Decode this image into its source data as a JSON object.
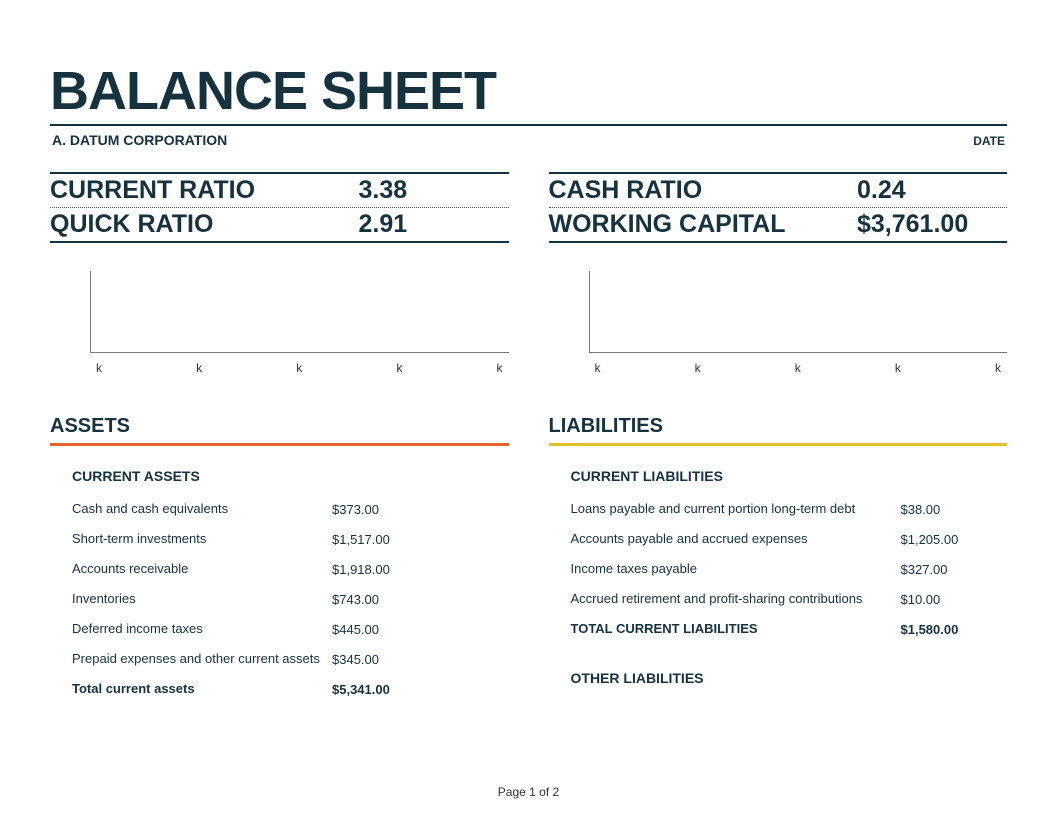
{
  "title": "BALANCE SHEET",
  "company": "A. DATUM CORPORATION",
  "date_label": "DATE",
  "ratios": {
    "left": [
      {
        "label": "CURRENT RATIO",
        "value": "3.38"
      },
      {
        "label": "QUICK RATIO",
        "value": "2.91"
      }
    ],
    "right": [
      {
        "label": "CASH RATIO",
        "value": "0.24"
      },
      {
        "label": "WORKING CAPITAL",
        "value": "$3,761.00"
      }
    ]
  },
  "chart_data": [
    {
      "type": "bar",
      "categories": [
        "k",
        "k",
        "k",
        "k",
        "k"
      ],
      "values": [],
      "title": "",
      "xlabel": "",
      "ylabel": ""
    },
    {
      "type": "bar",
      "categories": [
        "k",
        "k",
        "k",
        "k",
        "k"
      ],
      "values": [],
      "title": "",
      "xlabel": "",
      "ylabel": ""
    }
  ],
  "assets": {
    "header": "ASSETS",
    "current_title": "CURRENT ASSETS",
    "rows": [
      {
        "label": "Cash and cash equivalents",
        "value": "$373.00"
      },
      {
        "label": "Short-term investments",
        "value": "$1,517.00"
      },
      {
        "label": "Accounts receivable",
        "value": "$1,918.00"
      },
      {
        "label": "Inventories",
        "value": "$743.00"
      },
      {
        "label": "Deferred income taxes",
        "value": "$445.00"
      },
      {
        "label": "Prepaid expenses and other current assets",
        "value": "$345.00"
      }
    ],
    "total": {
      "label": "Total current assets",
      "value": "$5,341.00"
    }
  },
  "liabilities": {
    "header": "LIABILITIES",
    "current_title": "CURRENT LIABILITIES",
    "rows": [
      {
        "label": "Loans payable and current portion long-term debt",
        "value": "$38.00"
      },
      {
        "label": "Accounts payable and accrued expenses",
        "value": "$1,205.00"
      },
      {
        "label": "Income taxes payable",
        "value": "$327.00"
      },
      {
        "label": "Accrued retirement and profit-sharing contributions",
        "value": "$10.00"
      }
    ],
    "total": {
      "label": "TOTAL CURRENT LIABILITIES",
      "value": "$1,580.00"
    },
    "other_title": "OTHER LIABILITIES"
  },
  "footer": "Page 1 of 2"
}
